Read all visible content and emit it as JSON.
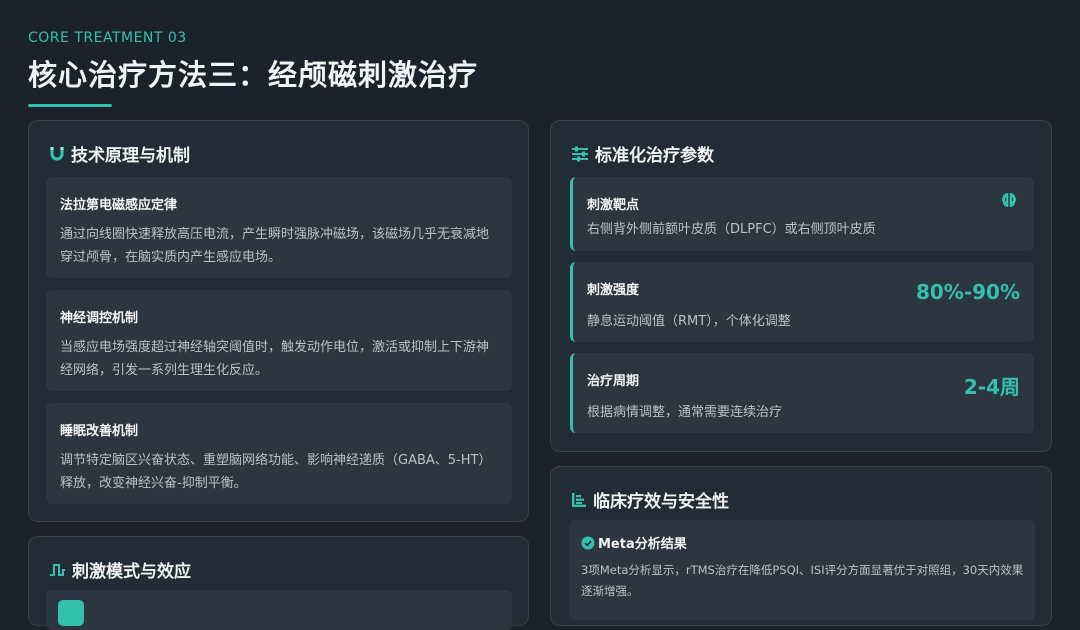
{
  "header": {
    "eyebrow": "CORE TREATMENT 03",
    "title": "核心治疗方法三：经颅磁刺激治疗"
  },
  "mechanism": {
    "heading": "技术原理与机制",
    "items": [
      {
        "title": "法拉第电磁感应定律",
        "desc": "通过向线圈快速释放高压电流，产生瞬时强脉冲磁场，该磁场几乎无衰减地穿过颅骨，在脑实质内产生感应电场。"
      },
      {
        "title": "神经调控机制",
        "desc": "当感应电场强度超过神经轴突阈值时，触发动作电位，激活或抑制上下游神经网络，引发一系列生理生化反应。"
      },
      {
        "title": "睡眠改善机制",
        "desc": "调节特定脑区兴奋状态、重塑脑网络功能、影响神经递质（GABA、5-HT）释放，改变神经兴奋-抑制平衡。"
      }
    ]
  },
  "mode": {
    "heading": "刺激模式与效应"
  },
  "params": {
    "heading": "标准化治疗参数",
    "items": [
      {
        "title": "刺激靶点",
        "desc": "右侧背外侧前额叶皮质（DLPFC）或右侧顶叶皮质",
        "icon": "brain-icon"
      },
      {
        "title": "刺激强度",
        "desc": "静息运动阈值（RMT），个体化调整",
        "value": "80%-90%"
      },
      {
        "title": "治疗周期",
        "desc": "根据病情调整，通常需要连续治疗",
        "value": "2-4周"
      }
    ]
  },
  "clinical": {
    "heading": "临床疗效与安全性",
    "meta": {
      "title": "Meta分析结果",
      "desc": "3项Meta分析显示，rTMS治疗在降低PSQI、ISI评分方面显著优于对照组，30天内效果逐渐增强。"
    }
  },
  "colors": {
    "accent": "#33c1ad",
    "background": "#1b222b",
    "card": "#222c36",
    "item": "#2b3640"
  }
}
